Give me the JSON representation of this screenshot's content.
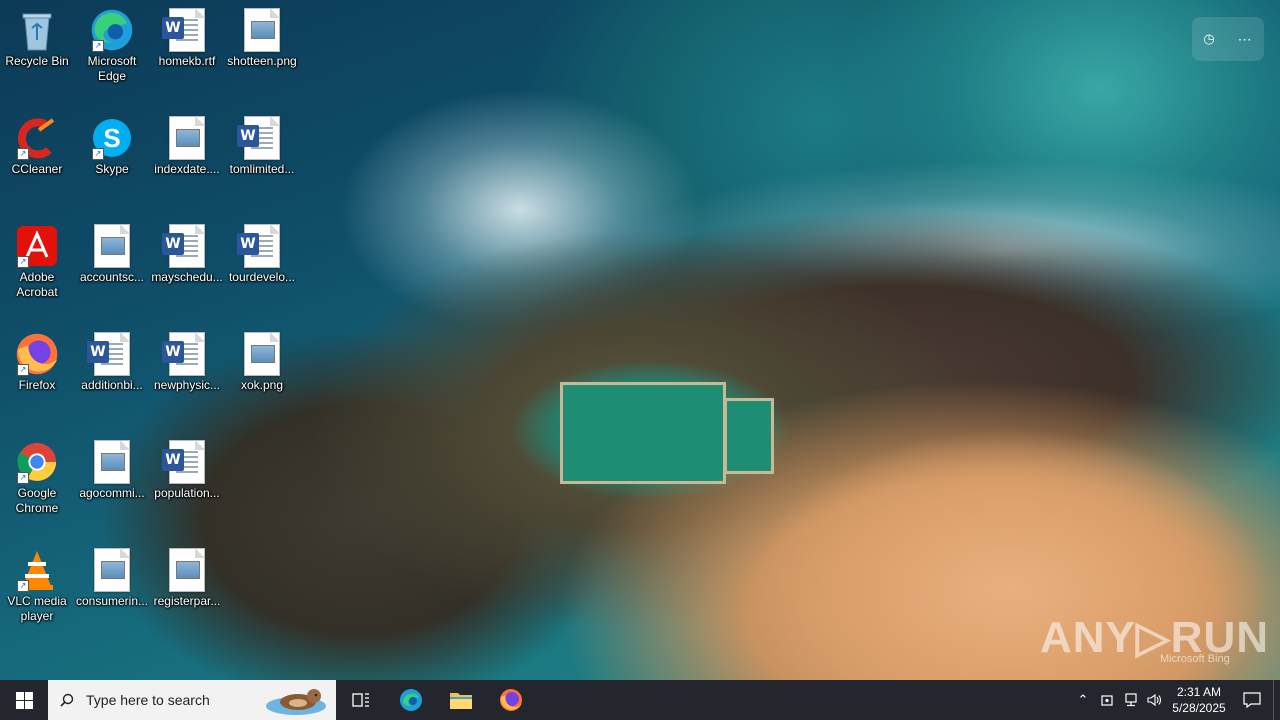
{
  "desktop": {
    "icons": [
      {
        "label": "Recycle Bin",
        "icon": "recycle-bin-icon",
        "shortcut": false
      },
      {
        "label": "Microsoft Edge",
        "icon": "edge-icon",
        "shortcut": true
      },
      {
        "label": "homekb.rtf",
        "icon": "word-doc-icon",
        "shortcut": false
      },
      {
        "label": "shotteen.png",
        "icon": "image-file-icon",
        "shortcut": false
      },
      {
        "label": "CCleaner",
        "icon": "ccleaner-icon",
        "shortcut": true
      },
      {
        "label": "Skype",
        "icon": "skype-icon",
        "shortcut": true
      },
      {
        "label": "indexdate....",
        "icon": "image-file-icon",
        "shortcut": false
      },
      {
        "label": "tomlimited...",
        "icon": "word-doc-icon",
        "shortcut": false
      },
      {
        "label": "Adobe Acrobat",
        "icon": "acrobat-icon",
        "shortcut": true
      },
      {
        "label": "accountsc...",
        "icon": "image-file-icon",
        "shortcut": false
      },
      {
        "label": "mayschedu...",
        "icon": "word-doc-icon",
        "shortcut": false
      },
      {
        "label": "tourdevelo...",
        "icon": "word-doc-icon",
        "shortcut": false
      },
      {
        "label": "Firefox",
        "icon": "firefox-icon",
        "shortcut": true
      },
      {
        "label": "additionbi...",
        "icon": "word-doc-icon",
        "shortcut": false
      },
      {
        "label": "newphysic...",
        "icon": "word-doc-icon",
        "shortcut": false
      },
      {
        "label": "xok.png",
        "icon": "image-file-icon",
        "shortcut": false
      },
      {
        "label": "Google Chrome",
        "icon": "chrome-icon",
        "shortcut": true
      },
      {
        "label": "agocommi...",
        "icon": "image-file-icon",
        "shortcut": false
      },
      {
        "label": "population...",
        "icon": "word-doc-icon",
        "shortcut": false
      },
      {
        "label": "VLC media player",
        "icon": "vlc-icon",
        "shortcut": true
      },
      {
        "label": "consumerin...",
        "icon": "image-file-icon",
        "shortcut": false
      },
      {
        "label": "registerpar...",
        "icon": "image-file-icon",
        "shortcut": false
      }
    ]
  },
  "watermark": {
    "text": "ANY▷RUN",
    "bing": "Microsoft Bing"
  },
  "taskbar": {
    "search_placeholder": "Type here to search",
    "apps": [
      "task-view-icon",
      "edge-icon",
      "file-explorer-icon",
      "firefox-icon"
    ],
    "clock": {
      "time": "2:31 AM",
      "date": "5/28/2025"
    }
  },
  "colors": {
    "taskbar": "#12161c",
    "word": "#2b579a",
    "accent": "#0078d7"
  }
}
